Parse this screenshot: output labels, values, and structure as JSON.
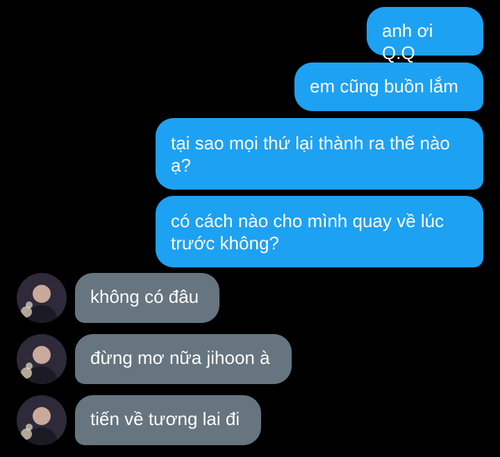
{
  "conversation": {
    "sent": [
      "anh ơi Q.Q",
      "em cũng buồn lắm",
      "tại sao mọi thứ lại thành ra thế nào ạ?",
      "có cách nào cho mình quay về lúc trước không?"
    ],
    "received": [
      "không có đâu",
      "đừng mơ nữa jihoon à",
      "tiến về tương lai đi"
    ]
  },
  "colors": {
    "background": "#000000",
    "sent_bubble": "#1da1f2",
    "received_bubble": "#66757f",
    "text": "#ffffff"
  }
}
